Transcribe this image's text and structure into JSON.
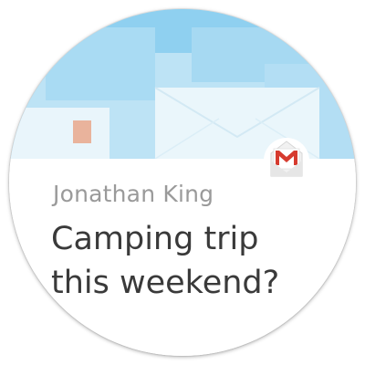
{
  "notification": {
    "app_icon": "gmail-icon",
    "sender": "Jonathan King",
    "subject": "Camping trip this weekend?"
  },
  "colors": {
    "header_sky": "#8fd0f0",
    "header_light": "#d6eef9",
    "envelope": "#e9f5fb",
    "stamp": "#e9b39c",
    "gmail_red": "#d63b2f",
    "sender_text": "#9a9a9a",
    "subject_text": "#3a3a3a"
  }
}
